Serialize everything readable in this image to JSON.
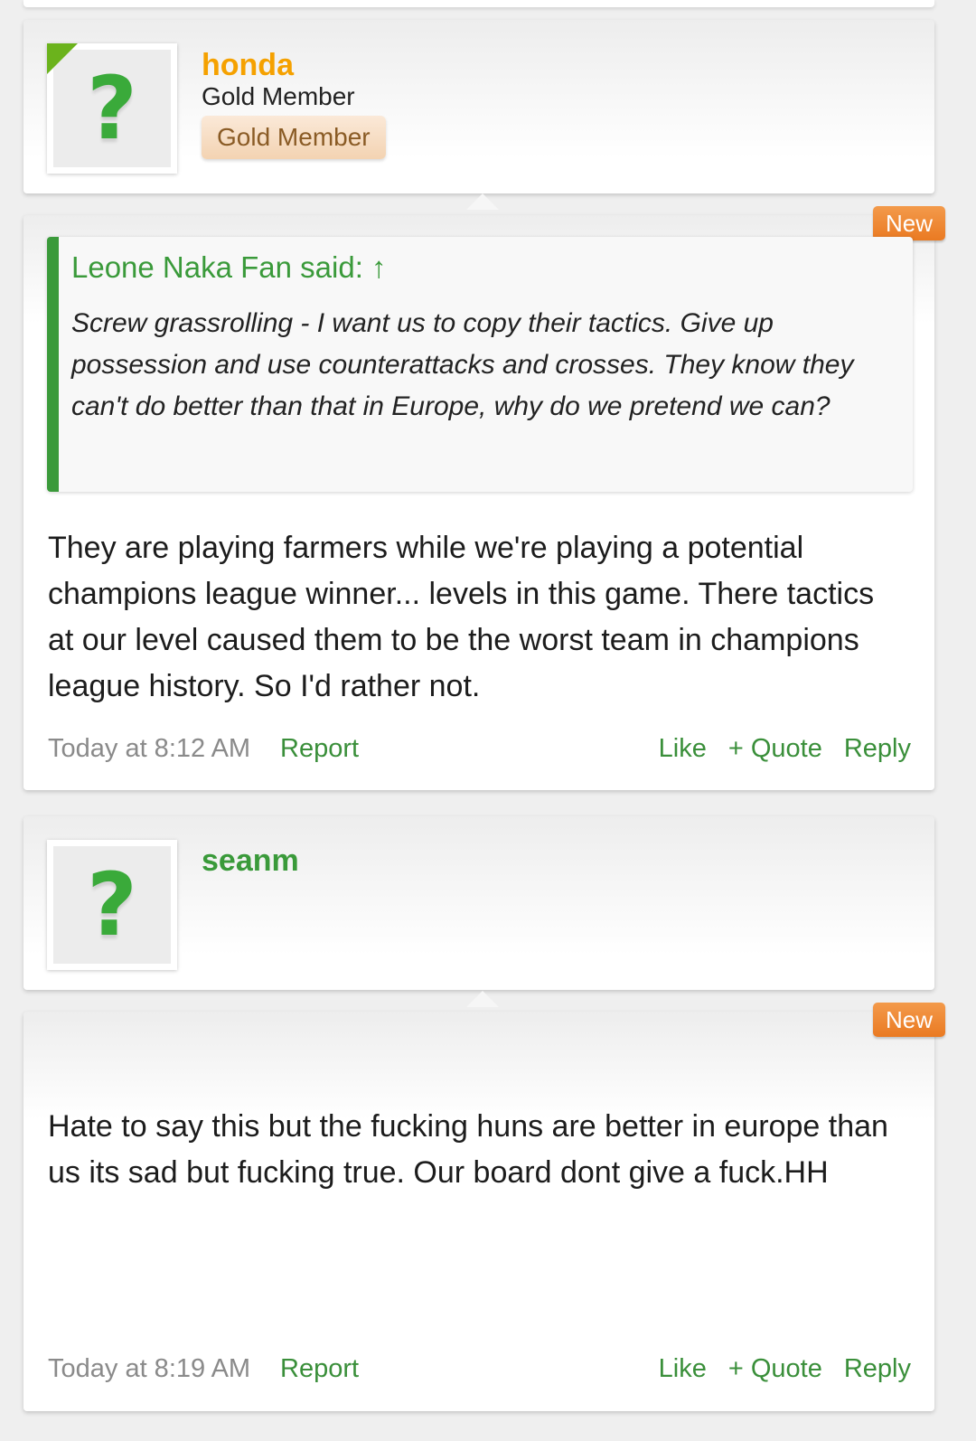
{
  "posts": [
    {
      "username": "honda",
      "username_color": "#f5a100",
      "user_title": "Gold Member",
      "user_banner": "Gold Member",
      "online_indicator": true,
      "new_badge": "New",
      "quote": {
        "author": "Leone Naka Fan said: ↑",
        "text": "Screw grassrolling - I want us to copy their tactics. Give up possession and use counterattacks and crosses. They know they can't do better than that in Europe, why do we pretend we can?"
      },
      "body": "They are playing farmers while we're playing a potential champions league winner... levels in this game. There tactics at our level caused them to be the worst team in champions league history. So I'd rather not.",
      "timestamp": "Today at 8:12 AM",
      "report_label": "Report",
      "like_label": "Like",
      "quote_label": "+ Quote",
      "reply_label": "Reply"
    },
    {
      "username": "seanm",
      "username_color": "#3a9a3a",
      "new_badge": "New",
      "body": "Hate to say this but the fucking huns are better in europe than us its sad but fucking true. Our board dont give a fuck.HH",
      "timestamp": "Today at 8:19 AM",
      "report_label": "Report",
      "like_label": "Like",
      "quote_label": "+ Quote",
      "reply_label": "Reply"
    }
  ],
  "avatar_icon": "question-mark-icon",
  "accent_color": "#3a9a3a",
  "badge_color": "#ea7a22"
}
